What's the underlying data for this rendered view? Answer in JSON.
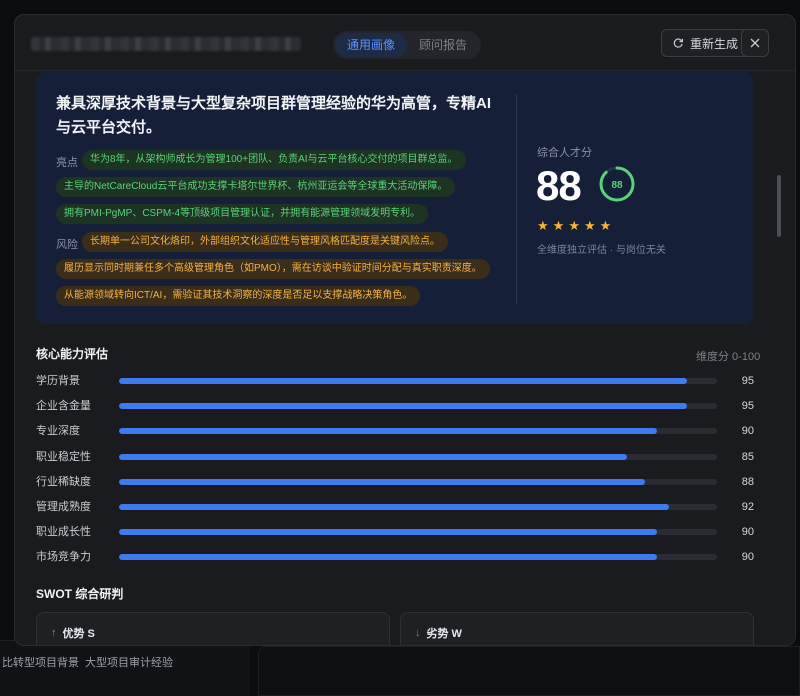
{
  "header": {
    "tabs": [
      {
        "label": "通用画像",
        "active": true
      },
      {
        "label": "顾问报告",
        "active": false
      }
    ],
    "regenerate_label": "重新生成",
    "close_icon": "close-icon"
  },
  "summary": {
    "headline": "兼具深厚技术背景与大型复杂项目群管理经验的华为高管，专精AI与云平台交付。",
    "highlights_label": "亮点",
    "highlights": [
      "华为8年，从架构师成长为管理100+团队、负责AI与云平台核心交付的项目群总监。",
      "主导的NetCareCloud云平台成功支撑卡塔尔世界杯、杭州亚运会等全球重大活动保障。",
      "拥有PMI-PgMP、CSPM-4等顶级项目管理认证，并拥有能源管理领域发明专利。"
    ],
    "risks_label": "风险",
    "risks": [
      "长期单一公司文化烙印，外部组织文化适应性与管理风格匹配度是关键风险点。",
      "履历显示同时期兼任多个高级管理角色（如PMO），需在访谈中验证时间分配与真实职责深度。",
      "从能源领域转向ICT/AI，需验证其技术洞察的深度是否足以支撑战略决策角色。"
    ],
    "score_label": "综合人才分",
    "score": "88",
    "score_ring": "88",
    "score_fraction": 0.88,
    "stars": 5,
    "score_note": "全维度独立评估 · 与岗位无关",
    "colors": {
      "good": "#5fd07a",
      "risk": "#f2b347",
      "ring": "#5fd07a"
    }
  },
  "abilities": {
    "title": "核心能力评估",
    "scale_note": "维度分 0-100",
    "items": [
      {
        "name": "学历背景",
        "value": "95"
      },
      {
        "name": "企业含金量",
        "value": "95"
      },
      {
        "name": "专业深度",
        "value": "90"
      },
      {
        "name": "职业稳定性",
        "value": "85"
      },
      {
        "name": "行业稀缺度",
        "value": "88"
      },
      {
        "name": "管理成熟度",
        "value": "92"
      },
      {
        "name": "职业成长性",
        "value": "90"
      },
      {
        "name": "市场竞争力",
        "value": "90"
      }
    ],
    "bar_color": "#3f7bf0"
  },
  "swot": {
    "title": "SWOT 综合研判",
    "strength": "优势 S",
    "weakness": "劣势 W"
  },
  "background": {
    "tags": [
      "比转型项目背景",
      "大型项目审计经验"
    ]
  }
}
